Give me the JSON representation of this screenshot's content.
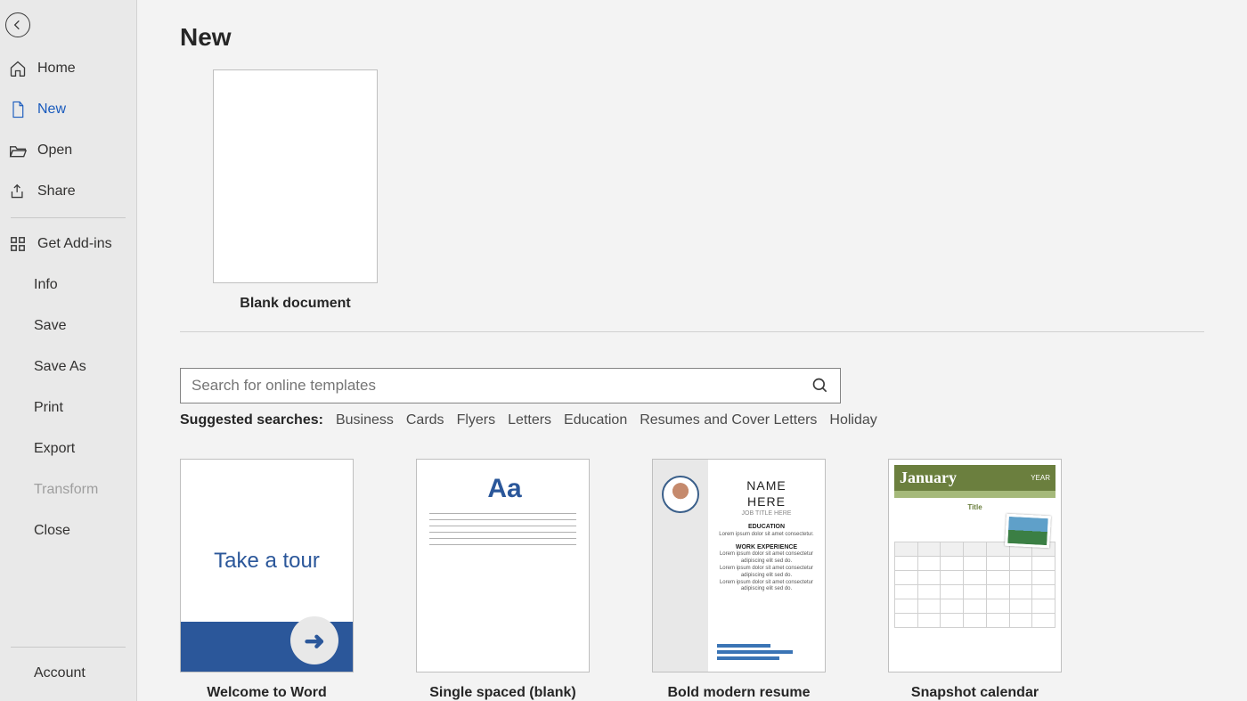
{
  "page": {
    "title": "New"
  },
  "sidebar": {
    "items": [
      {
        "label": "Home"
      },
      {
        "label": "New"
      },
      {
        "label": "Open"
      },
      {
        "label": "Share"
      },
      {
        "label": "Get Add-ins"
      },
      {
        "label": "Info"
      },
      {
        "label": "Save"
      },
      {
        "label": "Save As"
      },
      {
        "label": "Print"
      },
      {
        "label": "Export"
      },
      {
        "label": "Transform"
      },
      {
        "label": "Close"
      },
      {
        "label": "Account"
      }
    ]
  },
  "blank": {
    "label": "Blank document"
  },
  "search": {
    "placeholder": "Search for online templates"
  },
  "suggest": {
    "label": "Suggested searches:",
    "links": [
      "Business",
      "Cards",
      "Flyers",
      "Letters",
      "Education",
      "Resumes and Cover Letters",
      "Holiday"
    ]
  },
  "templates": [
    {
      "label": "Welcome to Word",
      "tour_text": "Take a tour"
    },
    {
      "label": "Single spaced (blank)",
      "aa": "Aa"
    },
    {
      "label": "Bold modern resume",
      "name": "NAME\nHERE",
      "subtitle": "JOB TITLE HERE"
    },
    {
      "label": "Snapshot calendar",
      "month": "January",
      "year": "YEAR",
      "title": "Title"
    }
  ]
}
